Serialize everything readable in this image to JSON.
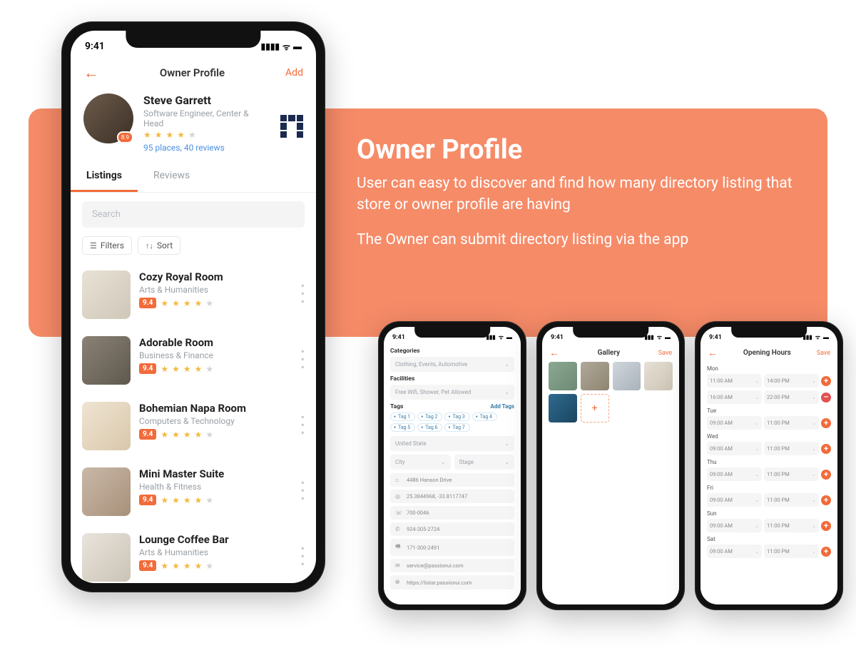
{
  "banner": {
    "title": "Owner Profile",
    "para1": "User can easy to discover and find how many directory listing that store or owner profile are having",
    "para2": "The Owner can submit directory listing via the app"
  },
  "status": {
    "time": "9:41"
  },
  "main": {
    "title": "Owner Profile",
    "action": "Add",
    "profile": {
      "name": "Steve Garrett",
      "role": "Software Engineer, Center & Head",
      "meta": "95 places, 40 reviews",
      "badge": "8.9",
      "rating": 4
    },
    "tabs": {
      "listings": "Listings",
      "reviews": "Reviews"
    },
    "search_placeholder": "Search",
    "filters": "Filters",
    "sort": "Sort",
    "listings": [
      {
        "title": "Cozy Royal Room",
        "category": "Arts & Humanities",
        "rating": "9.4",
        "stars": 4
      },
      {
        "title": "Adorable Room",
        "category": "Business & Finance",
        "rating": "9.4",
        "stars": 4
      },
      {
        "title": "Bohemian Napa Room",
        "category": "Computers & Technology",
        "rating": "9.4",
        "stars": 4
      },
      {
        "title": "Mini Master Suite",
        "category": "Health & Fitness",
        "rating": "9.4",
        "stars": 4
      },
      {
        "title": "Lounge Coffee Bar",
        "category": "Arts & Humanities",
        "rating": "9.4",
        "stars": 4
      }
    ]
  },
  "categories_screen": {
    "title": "Categories",
    "categories_value": "Clothing, Events, Automotive",
    "facilities_label": "Facilities",
    "facilities_value": "Free Wifi, Shower, Pet Allowed",
    "tags_label": "Tags",
    "add_tags": "Add Tags",
    "tags": [
      "Tag 1",
      "Tag 2",
      "Tag 3",
      "Tag 4",
      "Tag 5",
      "Tag 6",
      "Tag 7"
    ],
    "country": "United State",
    "city": "City",
    "stage": "Stage",
    "address": "4486 Hanson Drive",
    "coords": "25.3844968, -33.8117747",
    "phone1": "700-0046",
    "phone2": "924-305-2724",
    "phone3": "171-300-2491",
    "email": "service@passionui.com",
    "website": "https://listar.passionui.com"
  },
  "gallery_screen": {
    "title": "Gallery",
    "action": "Save"
  },
  "hours_screen": {
    "title": "Opening Hours",
    "action": "Save",
    "days": [
      {
        "name": "Mon",
        "slots": [
          {
            "from": "11:00 AM",
            "to": "14:00 PM"
          },
          {
            "from": "16:00 AM",
            "to": "22:00 PM"
          }
        ],
        "remove_second": true
      },
      {
        "name": "Tue",
        "slots": [
          {
            "from": "09:00 AM",
            "to": "11:00 PM"
          }
        ]
      },
      {
        "name": "Wed",
        "slots": [
          {
            "from": "09:00 AM",
            "to": "11:00 PM"
          }
        ]
      },
      {
        "name": "Thu",
        "slots": [
          {
            "from": "09:00 AM",
            "to": "11:00 PM"
          }
        ]
      },
      {
        "name": "Fri",
        "slots": [
          {
            "from": "09:00 AM",
            "to": "11:00 PM"
          }
        ]
      },
      {
        "name": "Sun",
        "slots": [
          {
            "from": "09:00 AM",
            "to": "11:00 PM"
          }
        ]
      },
      {
        "name": "Sat",
        "slots": [
          {
            "from": "09:00 AM",
            "to": "11:00 PM"
          }
        ]
      }
    ]
  }
}
